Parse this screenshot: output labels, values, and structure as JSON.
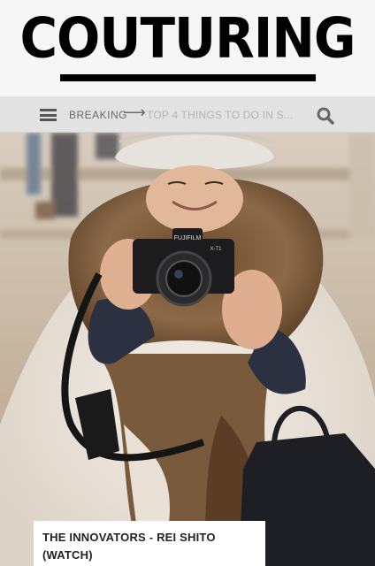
{
  "header": {
    "logo_text": "COUTURING"
  },
  "navbar": {
    "menu_icon": "hamburger-menu-icon",
    "breaking_label": "BREAKING",
    "arrow_icon": "right-arrow-icon",
    "ticker_text": "TOP 4 THINGS TO DO IN S...",
    "search_icon": "magnifier-search-icon"
  },
  "hero": {
    "camera_brand": "FUJIFILM",
    "camera_model": "X-T1"
  },
  "article": {
    "title": "THE INNOVATORS - REI SHITO (WATCH)"
  },
  "colors": {
    "header_bg": "#f6f6f6",
    "nav_bg": "#e2e2e2",
    "nav_text": "#6a6a6a",
    "ticker_text": "#b4b4b4",
    "logo": "#000000"
  }
}
